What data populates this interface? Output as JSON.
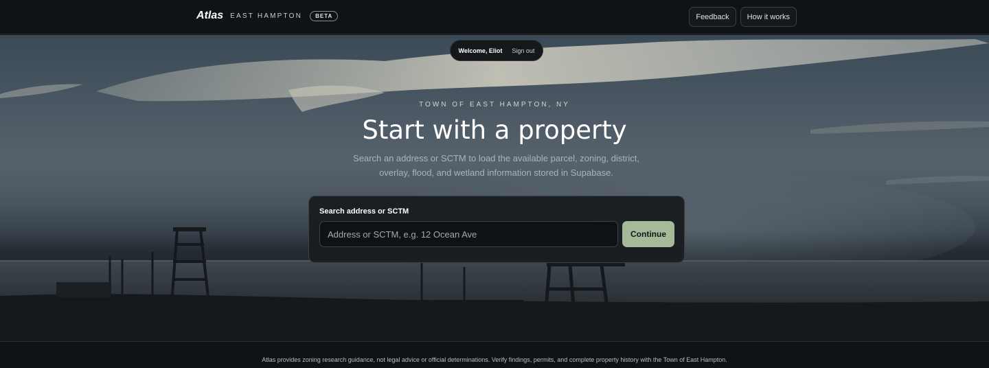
{
  "header": {
    "brand": "Atlas",
    "town": "EAST HAMPTON",
    "badge": "BETA",
    "nav": {
      "feedback": "Feedback",
      "how_it_works": "How it works"
    }
  },
  "session": {
    "welcome": "Welcome, Eliot",
    "sign_out": "Sign out"
  },
  "hero": {
    "eyebrow": "TOWN OF EAST HAMPTON, NY",
    "title": "Start with a property",
    "subtitle": "Search an address or SCTM to load the available parcel, zoning, district, overlay, flood, and wetland information stored in Supabase."
  },
  "search": {
    "label": "Search address or SCTM",
    "value": "",
    "placeholder": "Address or SCTM, e.g. 12 Ocean Ave",
    "button": "Continue"
  },
  "footer": {
    "disclaimer": "Atlas provides zoning research guidance, not legal advice or official determinations. Verify findings, permits, and complete property history with the Town of East Hampton."
  },
  "colors": {
    "accent": "#a6b998",
    "background": "#0f1215",
    "card": "#181c1f"
  }
}
